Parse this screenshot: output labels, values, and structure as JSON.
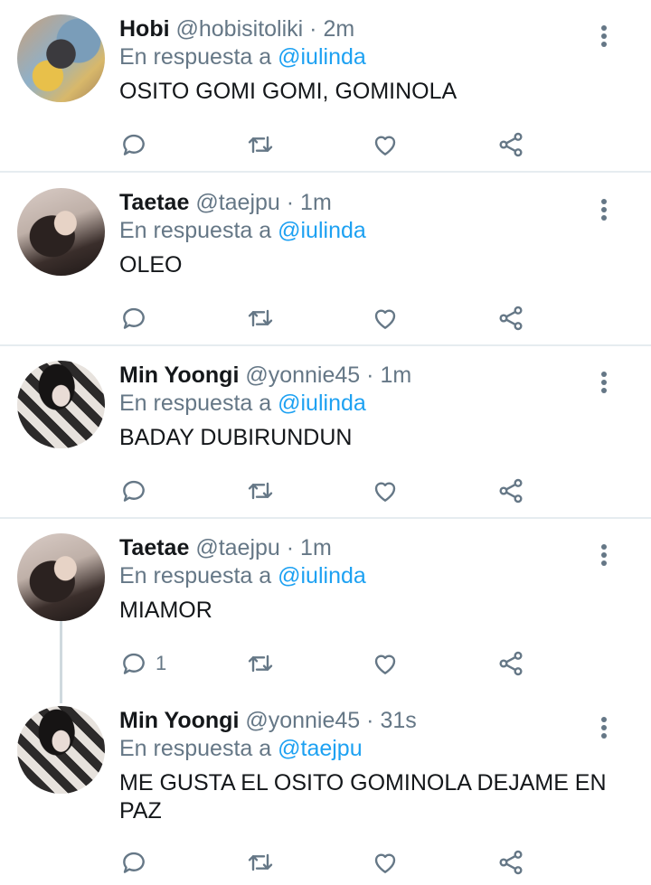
{
  "tweets": [
    {
      "name": "Hobi",
      "handle": "@hobisitoliki",
      "separator": "·",
      "time": "2m",
      "reply_prefix": "En respuesta a",
      "reply_to": "@iulinda",
      "text": "OSITO GOMI  GOMI, GOMINOLA",
      "reply_count": ""
    },
    {
      "name": "Taetae",
      "handle": "@taejpu",
      "separator": "·",
      "time": "1m",
      "reply_prefix": "En respuesta a",
      "reply_to": "@iulinda",
      "text": "OLEO",
      "reply_count": ""
    },
    {
      "name": "Min Yoongi",
      "handle": "@yonnie45",
      "separator": "·",
      "time": "1m",
      "reply_prefix": "En respuesta a",
      "reply_to": "@iulinda",
      "text": "BADAY DUBIRUNDUN",
      "reply_count": ""
    },
    {
      "name": "Taetae",
      "handle": "@taejpu",
      "separator": "·",
      "time": "1m",
      "reply_prefix": "En respuesta a",
      "reply_to": "@iulinda",
      "text": "MIAMOR",
      "reply_count": "1"
    },
    {
      "name": "Min Yoongi",
      "handle": "@yonnie45",
      "separator": "·",
      "time": "31s",
      "reply_prefix": "En respuesta a",
      "reply_to": "@taejpu",
      "text": "ME GUSTA EL OSITO GOMINOLA DEJAME EN PAZ",
      "reply_count": ""
    }
  ],
  "icons": {
    "reply": "reply-icon",
    "retweet": "retweet-icon",
    "like": "heart-icon",
    "share": "share-icon",
    "more": "more-vertical-icon"
  },
  "colors": {
    "text": "#14171a",
    "secondary": "#657786",
    "mention": "#1da1f2",
    "divider": "#e6ecf0"
  }
}
